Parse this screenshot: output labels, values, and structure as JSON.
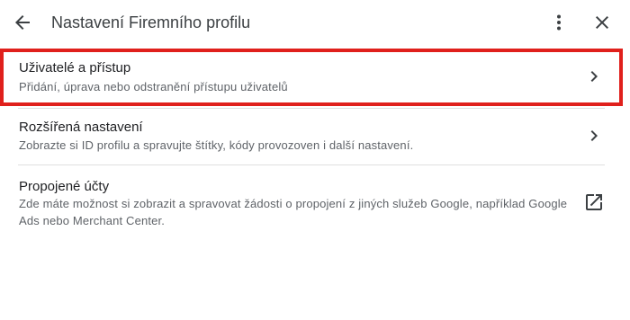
{
  "header": {
    "title": "Nastavení Firemního profilu",
    "icons": {
      "back": "arrow-back-icon",
      "more": "more-vert-icon",
      "close": "close-icon"
    }
  },
  "items": [
    {
      "title": "Uživatelé a přístup",
      "description": "Přidání, úprava nebo odstranění přístupu uživatelů",
      "icon": "chevron-right-icon",
      "highlighted": true
    },
    {
      "title": "Rozšířená nastavení",
      "description": "Zobrazte si ID profilu a spravujte štítky, kódy provozoven i další nastavení.",
      "icon": "chevron-right-icon"
    },
    {
      "title": "Propojené účty",
      "description": "Zde máte možnost si zobrazit a spravovat žádosti o propojení z jiných služeb Google, například Google Ads nebo Merchant Center.",
      "icon": "open-in-new-icon"
    }
  ],
  "colors": {
    "highlight_border": "#e0201c",
    "text_primary": "#202124",
    "text_secondary": "#5f6368",
    "divider": "#e0e0e0"
  }
}
